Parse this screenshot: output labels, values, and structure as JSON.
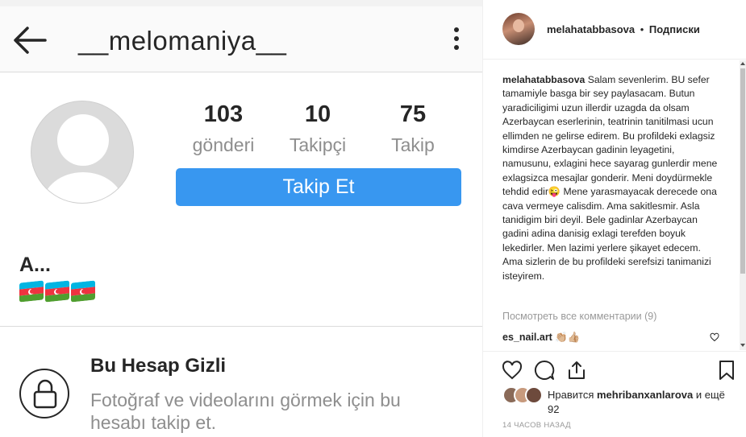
{
  "profile_screenshot": {
    "username": "__melomaniya__",
    "stats": [
      {
        "value": "103",
        "label": "gönderi"
      },
      {
        "value": "10",
        "label": "Takipçi"
      },
      {
        "value": "75",
        "label": "Takip"
      }
    ],
    "follow_button": "Takip Et",
    "full_name": "A...",
    "bio_icons": [
      "azerbaijan-flag",
      "azerbaijan-flag",
      "azerbaijan-flag"
    ],
    "private_title": "Bu Hesap Gizli",
    "private_text": "Fotoğraf ve videolarını görmek için bu hesabı takip et."
  },
  "post": {
    "author": "melahatabbasova",
    "separator": "•",
    "subscriptions": "Подписки",
    "caption_user": "melahatabbasova",
    "caption_text": "Salam sevenlerim. BU sefer tamamiyle basga bir sey paylasacam. Butun yaradiciligimi uzun illerdir uzagda da olsam Azerbaycan eserlerinin, teatrinin tanitilmasi ucun ellimden ne gelirse edirem. Bu profildeki exlagsiz kimdirse Azerbaycan gadinin leyagetini, namusunu, exlagini hece sayarag gunlerdir mene exlagsizca mesajlar gonderir. Meni doydürmekle tehdid edir😜 Mene yarasmayacak derecede ona cava vermeye calisdim. Ama sakitlesmir. Asla tanidigim biri deyil. Bele gadinlar Azerbaycan gadini adina danisig exlagi terefden boyuk lekedirler. Men lazimi yerlere şikayet edecem. Ama sizlerin de bu profildeki serefsizi tanimanizi isteyirem.",
    "view_all_comments": "Посмотреть все комментарии (9)",
    "comment_user": "es_nail.art",
    "comment_text": "👏🏼👍🏼",
    "likes_prefix": "Нравится",
    "likes_user": "mehribanxanlarova",
    "likes_suffix": "и ещё 92",
    "time_ago": "14 ЧАСОВ НАЗАД"
  },
  "colors": {
    "follow_blue": "#3897f0",
    "text_dark": "#262626",
    "text_gray": "#8e8e8e",
    "flag_blue": "#00b5e2",
    "flag_red": "#ef3340",
    "flag_green": "#509e2f"
  }
}
